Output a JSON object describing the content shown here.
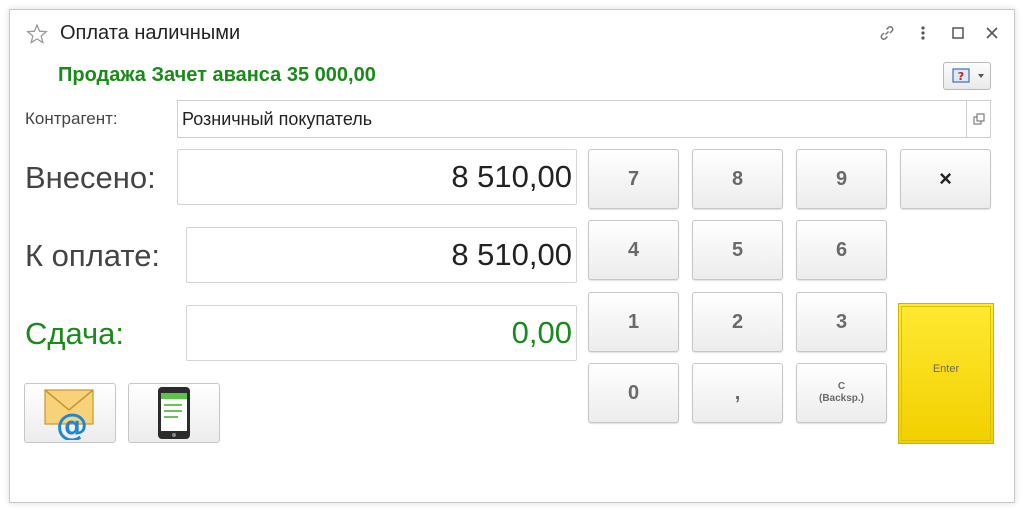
{
  "window": {
    "title": "Оплата наличными",
    "subtitle": "Продажа Зачет аванса 35 000,00"
  },
  "contractor": {
    "label": "Контрагент:",
    "value": "Розничный покупатель"
  },
  "payment": {
    "paid_label": "Внесено:",
    "paid_value": "8 510,00",
    "due_label": "К оплате:",
    "due_value": "8 510,00",
    "change_label": "Сдача:",
    "change_value": "0,00"
  },
  "keypad": {
    "k7": "7",
    "k8": "8",
    "k9": "9",
    "clear": "×",
    "k4": "4",
    "k5": "5",
    "k6": "6",
    "k1": "1",
    "k2": "2",
    "k3": "3",
    "k0": "0",
    "comma": ",",
    "backspace_line1": "C",
    "backspace_line2": "(Backsp.)",
    "enter": "Enter"
  },
  "colors": {
    "accent_green": "#1a8a1a",
    "enter_yellow": "#f7dc16"
  },
  "icons": {
    "star": "star-icon",
    "link": "link-icon",
    "more": "more-vertical-icon",
    "maximize": "maximize-icon",
    "close": "close-icon",
    "help": "help-icon",
    "open": "open-form-icon",
    "email": "email-icon",
    "phone": "mobile-receipt-icon"
  }
}
